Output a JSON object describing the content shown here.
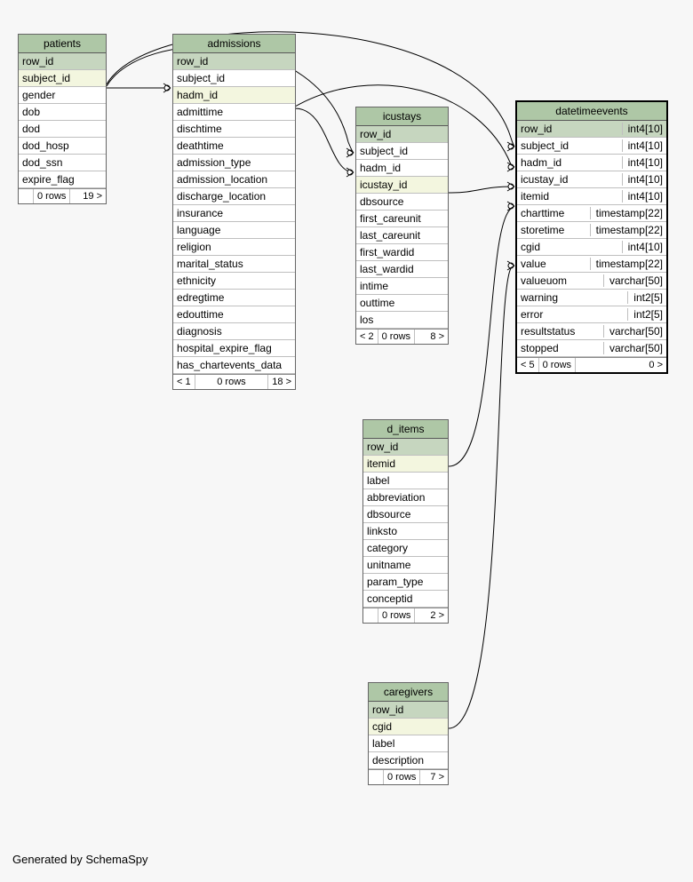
{
  "footer_text": "Generated by SchemaSpy",
  "tables": {
    "patients": {
      "title": "patients",
      "columns": [
        {
          "name": "row_id",
          "role": "pk"
        },
        {
          "name": "subject_id",
          "role": "fk"
        },
        {
          "name": "gender",
          "role": ""
        },
        {
          "name": "dob",
          "role": ""
        },
        {
          "name": "dod",
          "role": ""
        },
        {
          "name": "dod_hosp",
          "role": ""
        },
        {
          "name": "dod_ssn",
          "role": ""
        },
        {
          "name": "expire_flag",
          "role": ""
        }
      ],
      "footer": {
        "left": "",
        "mid": "0 rows",
        "right": "19 >"
      }
    },
    "admissions": {
      "title": "admissions",
      "columns": [
        {
          "name": "row_id",
          "role": "pk"
        },
        {
          "name": "subject_id",
          "role": ""
        },
        {
          "name": "hadm_id",
          "role": "fk"
        },
        {
          "name": "admittime",
          "role": ""
        },
        {
          "name": "dischtime",
          "role": ""
        },
        {
          "name": "deathtime",
          "role": ""
        },
        {
          "name": "admission_type",
          "role": ""
        },
        {
          "name": "admission_location",
          "role": ""
        },
        {
          "name": "discharge_location",
          "role": ""
        },
        {
          "name": "insurance",
          "role": ""
        },
        {
          "name": "language",
          "role": ""
        },
        {
          "name": "religion",
          "role": ""
        },
        {
          "name": "marital_status",
          "role": ""
        },
        {
          "name": "ethnicity",
          "role": ""
        },
        {
          "name": "edregtime",
          "role": ""
        },
        {
          "name": "edouttime",
          "role": ""
        },
        {
          "name": "diagnosis",
          "role": ""
        },
        {
          "name": "hospital_expire_flag",
          "role": ""
        },
        {
          "name": "has_chartevents_data",
          "role": ""
        }
      ],
      "footer": {
        "left": "< 1",
        "mid": "0 rows",
        "right": "18 >"
      }
    },
    "icustays": {
      "title": "icustays",
      "columns": [
        {
          "name": "row_id",
          "role": "pk"
        },
        {
          "name": "subject_id",
          "role": ""
        },
        {
          "name": "hadm_id",
          "role": ""
        },
        {
          "name": "icustay_id",
          "role": "fk"
        },
        {
          "name": "dbsource",
          "role": ""
        },
        {
          "name": "first_careunit",
          "role": ""
        },
        {
          "name": "last_careunit",
          "role": ""
        },
        {
          "name": "first_wardid",
          "role": ""
        },
        {
          "name": "last_wardid",
          "role": ""
        },
        {
          "name": "intime",
          "role": ""
        },
        {
          "name": "outtime",
          "role": ""
        },
        {
          "name": "los",
          "role": ""
        }
      ],
      "footer": {
        "left": "< 2",
        "mid": "0 rows",
        "right": "8 >"
      }
    },
    "d_items": {
      "title": "d_items",
      "columns": [
        {
          "name": "row_id",
          "role": "pk"
        },
        {
          "name": "itemid",
          "role": "fk"
        },
        {
          "name": "label",
          "role": ""
        },
        {
          "name": "abbreviation",
          "role": ""
        },
        {
          "name": "dbsource",
          "role": ""
        },
        {
          "name": "linksto",
          "role": ""
        },
        {
          "name": "category",
          "role": ""
        },
        {
          "name": "unitname",
          "role": ""
        },
        {
          "name": "param_type",
          "role": ""
        },
        {
          "name": "conceptid",
          "role": ""
        }
      ],
      "footer": {
        "left": "",
        "mid": "0 rows",
        "right": "2 >"
      }
    },
    "caregivers": {
      "title": "caregivers",
      "columns": [
        {
          "name": "row_id",
          "role": "pk"
        },
        {
          "name": "cgid",
          "role": "fk"
        },
        {
          "name": "label",
          "role": ""
        },
        {
          "name": "description",
          "role": ""
        }
      ],
      "footer": {
        "left": "",
        "mid": "0 rows",
        "right": "7 >"
      }
    },
    "datetimeevents": {
      "title": "datetimeevents",
      "columns": [
        {
          "name": "row_id",
          "type": "int4[10]",
          "role": "pk"
        },
        {
          "name": "subject_id",
          "type": "int4[10]",
          "role": ""
        },
        {
          "name": "hadm_id",
          "type": "int4[10]",
          "role": ""
        },
        {
          "name": "icustay_id",
          "type": "int4[10]",
          "role": ""
        },
        {
          "name": "itemid",
          "type": "int4[10]",
          "role": ""
        },
        {
          "name": "charttime",
          "type": "timestamp[22]",
          "role": ""
        },
        {
          "name": "storetime",
          "type": "timestamp[22]",
          "role": ""
        },
        {
          "name": "cgid",
          "type": "int4[10]",
          "role": ""
        },
        {
          "name": "value",
          "type": "timestamp[22]",
          "role": ""
        },
        {
          "name": "valueuom",
          "type": "varchar[50]",
          "role": ""
        },
        {
          "name": "warning",
          "type": "int2[5]",
          "role": ""
        },
        {
          "name": "error",
          "type": "int2[5]",
          "role": ""
        },
        {
          "name": "resultstatus",
          "type": "varchar[50]",
          "role": ""
        },
        {
          "name": "stopped",
          "type": "varchar[50]",
          "role": ""
        }
      ],
      "footer": {
        "left": "< 5",
        "mid": "0 rows",
        "right": "0 >"
      }
    }
  }
}
